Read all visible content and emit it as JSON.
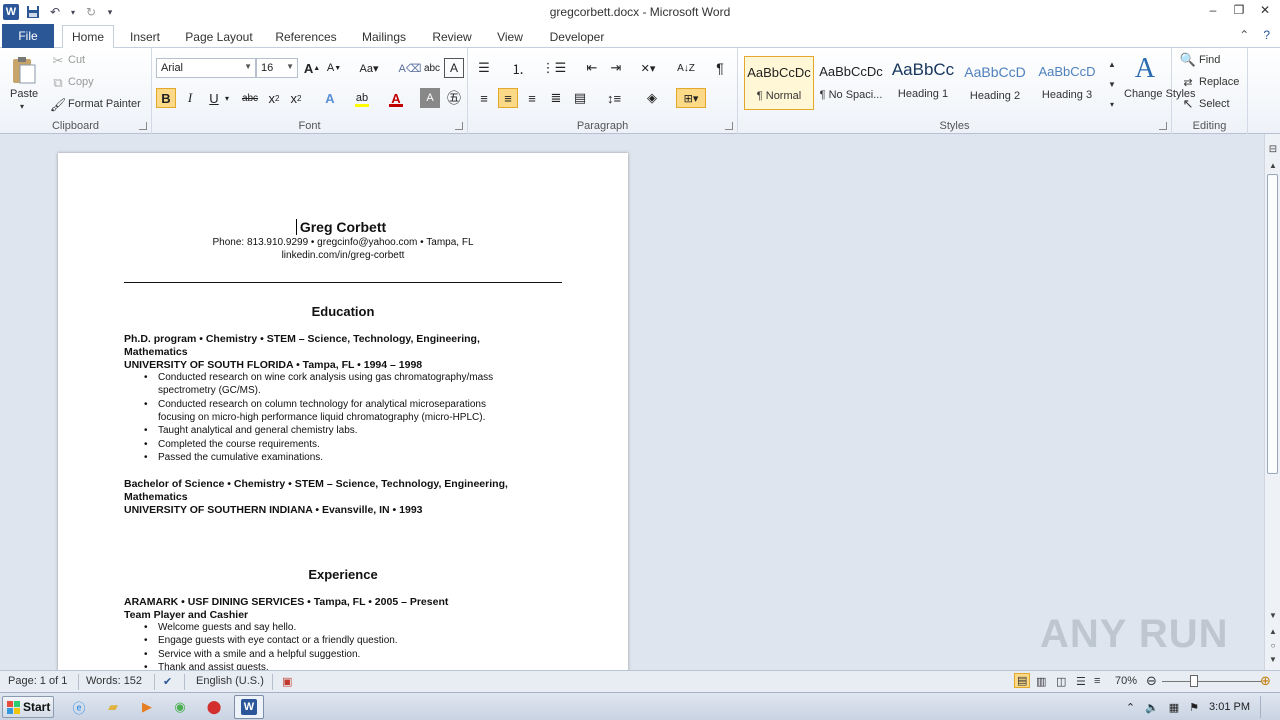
{
  "window": {
    "title": "gregcorbett.docx - Microsoft Word",
    "app_icon": "W"
  },
  "tabs": [
    "File",
    "Home",
    "Insert",
    "Page Layout",
    "References",
    "Mailings",
    "Review",
    "View",
    "Developer"
  ],
  "active_tab": "Home",
  "ribbon": {
    "clipboard": {
      "label": "Clipboard",
      "paste": "Paste",
      "cut": "Cut",
      "copy": "Copy",
      "format_painter": "Format Painter"
    },
    "font": {
      "label": "Font",
      "font_name": "Arial",
      "font_size": "16"
    },
    "paragraph": {
      "label": "Paragraph"
    },
    "styles": {
      "label": "Styles",
      "items": [
        {
          "sample": "AaBbCcDc",
          "name": "¶ Normal"
        },
        {
          "sample": "AaBbCcDc",
          "name": "¶ No Spaci..."
        },
        {
          "sample": "AaBbCc",
          "name": "Heading 1"
        },
        {
          "sample": "AaBbCcD",
          "name": "Heading 2"
        },
        {
          "sample": "AaBbCcD",
          "name": "Heading 3"
        }
      ],
      "change_styles": "Change Styles"
    },
    "editing": {
      "label": "Editing",
      "find": "Find",
      "replace": "Replace",
      "select": "Select"
    }
  },
  "document": {
    "name": "Greg Corbett",
    "contact_line1": "Phone:  813.910.9299  • gregcinfo@yahoo.com  • Tampa,  FL",
    "contact_line2": "linkedin.com/in/greg-corbett",
    "education_heading": "Education",
    "phd_line1": "Ph.D.  program • Chemistry • STEM  – Science, Technology, Engineering,",
    "phd_line2": "Mathematics",
    "phd_school": "UNIVERSITY  OF  SOUTH  FLORIDA  • Tampa, FL • 1994 – 1998",
    "phd_bullets": [
      {
        "l1": "Conducted  research on wine cork analysis using gas chromatography/mass",
        "l2": "spectrometry (GC/MS)."
      },
      {
        "l1": "Conducted  research on column technology for analytical microseparations",
        "l2": "focusing on micro-high performance liquid chromatography (micro-HPLC)."
      },
      {
        "l1": "Taught  analytical and general chemistry labs.",
        "l2": ""
      },
      {
        "l1": "Completed  the course requirements.",
        "l2": ""
      },
      {
        "l1": "Passed the cumulative  examinations.",
        "l2": ""
      }
    ],
    "bs_line1": "Bachelor of Science • Chemistry • STEM  – Science, Technology, Engineering,",
    "bs_line2": "Mathematics",
    "bs_school": "UNIVERSITY  OF  SOUTHERN  INDIANA  • Evansville, IN • 1993",
    "experience_heading": "Experience",
    "job_line": "ARAMARK  • USF  DINING  SERVICES   • Tampa, FL • 2005  – Present",
    "job_title": "Team Player and Cashier",
    "job_bullets": [
      "Welcome  guests and say hello.",
      "Engage  guests with eye contact or a friendly question.",
      "Service with a smile and a helpful suggestion.",
      "Thank  and assist guests."
    ]
  },
  "status": {
    "page": "Page: 1 of 1",
    "words": "Words: 152",
    "language": "English (U.S.)",
    "zoom": "70%"
  },
  "taskbar": {
    "start": "Start",
    "time": "3:01 PM"
  },
  "watermark": "ANY RUN"
}
